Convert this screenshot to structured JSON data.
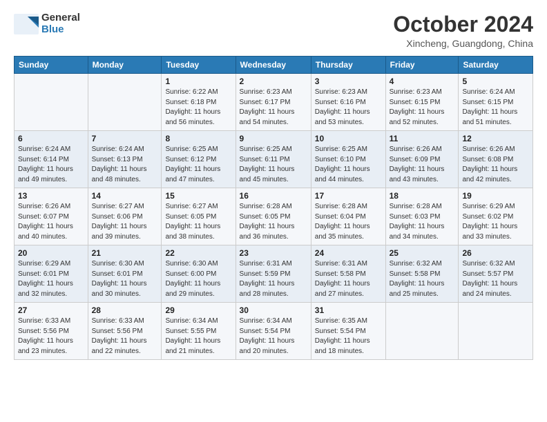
{
  "header": {
    "logo_line1": "General",
    "logo_line2": "Blue",
    "title": "October 2024",
    "subtitle": "Xincheng, Guangdong, China"
  },
  "days_of_week": [
    "Sunday",
    "Monday",
    "Tuesday",
    "Wednesday",
    "Thursday",
    "Friday",
    "Saturday"
  ],
  "weeks": [
    [
      {
        "num": "",
        "detail": ""
      },
      {
        "num": "",
        "detail": ""
      },
      {
        "num": "1",
        "detail": "Sunrise: 6:22 AM\nSunset: 6:18 PM\nDaylight: 11 hours\nand 56 minutes."
      },
      {
        "num": "2",
        "detail": "Sunrise: 6:23 AM\nSunset: 6:17 PM\nDaylight: 11 hours\nand 54 minutes."
      },
      {
        "num": "3",
        "detail": "Sunrise: 6:23 AM\nSunset: 6:16 PM\nDaylight: 11 hours\nand 53 minutes."
      },
      {
        "num": "4",
        "detail": "Sunrise: 6:23 AM\nSunset: 6:15 PM\nDaylight: 11 hours\nand 52 minutes."
      },
      {
        "num": "5",
        "detail": "Sunrise: 6:24 AM\nSunset: 6:15 PM\nDaylight: 11 hours\nand 51 minutes."
      }
    ],
    [
      {
        "num": "6",
        "detail": "Sunrise: 6:24 AM\nSunset: 6:14 PM\nDaylight: 11 hours\nand 49 minutes."
      },
      {
        "num": "7",
        "detail": "Sunrise: 6:24 AM\nSunset: 6:13 PM\nDaylight: 11 hours\nand 48 minutes."
      },
      {
        "num": "8",
        "detail": "Sunrise: 6:25 AM\nSunset: 6:12 PM\nDaylight: 11 hours\nand 47 minutes."
      },
      {
        "num": "9",
        "detail": "Sunrise: 6:25 AM\nSunset: 6:11 PM\nDaylight: 11 hours\nand 45 minutes."
      },
      {
        "num": "10",
        "detail": "Sunrise: 6:25 AM\nSunset: 6:10 PM\nDaylight: 11 hours\nand 44 minutes."
      },
      {
        "num": "11",
        "detail": "Sunrise: 6:26 AM\nSunset: 6:09 PM\nDaylight: 11 hours\nand 43 minutes."
      },
      {
        "num": "12",
        "detail": "Sunrise: 6:26 AM\nSunset: 6:08 PM\nDaylight: 11 hours\nand 42 minutes."
      }
    ],
    [
      {
        "num": "13",
        "detail": "Sunrise: 6:26 AM\nSunset: 6:07 PM\nDaylight: 11 hours\nand 40 minutes."
      },
      {
        "num": "14",
        "detail": "Sunrise: 6:27 AM\nSunset: 6:06 PM\nDaylight: 11 hours\nand 39 minutes."
      },
      {
        "num": "15",
        "detail": "Sunrise: 6:27 AM\nSunset: 6:05 PM\nDaylight: 11 hours\nand 38 minutes."
      },
      {
        "num": "16",
        "detail": "Sunrise: 6:28 AM\nSunset: 6:05 PM\nDaylight: 11 hours\nand 36 minutes."
      },
      {
        "num": "17",
        "detail": "Sunrise: 6:28 AM\nSunset: 6:04 PM\nDaylight: 11 hours\nand 35 minutes."
      },
      {
        "num": "18",
        "detail": "Sunrise: 6:28 AM\nSunset: 6:03 PM\nDaylight: 11 hours\nand 34 minutes."
      },
      {
        "num": "19",
        "detail": "Sunrise: 6:29 AM\nSunset: 6:02 PM\nDaylight: 11 hours\nand 33 minutes."
      }
    ],
    [
      {
        "num": "20",
        "detail": "Sunrise: 6:29 AM\nSunset: 6:01 PM\nDaylight: 11 hours\nand 32 minutes."
      },
      {
        "num": "21",
        "detail": "Sunrise: 6:30 AM\nSunset: 6:01 PM\nDaylight: 11 hours\nand 30 minutes."
      },
      {
        "num": "22",
        "detail": "Sunrise: 6:30 AM\nSunset: 6:00 PM\nDaylight: 11 hours\nand 29 minutes."
      },
      {
        "num": "23",
        "detail": "Sunrise: 6:31 AM\nSunset: 5:59 PM\nDaylight: 11 hours\nand 28 minutes."
      },
      {
        "num": "24",
        "detail": "Sunrise: 6:31 AM\nSunset: 5:58 PM\nDaylight: 11 hours\nand 27 minutes."
      },
      {
        "num": "25",
        "detail": "Sunrise: 6:32 AM\nSunset: 5:58 PM\nDaylight: 11 hours\nand 25 minutes."
      },
      {
        "num": "26",
        "detail": "Sunrise: 6:32 AM\nSunset: 5:57 PM\nDaylight: 11 hours\nand 24 minutes."
      }
    ],
    [
      {
        "num": "27",
        "detail": "Sunrise: 6:33 AM\nSunset: 5:56 PM\nDaylight: 11 hours\nand 23 minutes."
      },
      {
        "num": "28",
        "detail": "Sunrise: 6:33 AM\nSunset: 5:56 PM\nDaylight: 11 hours\nand 22 minutes."
      },
      {
        "num": "29",
        "detail": "Sunrise: 6:34 AM\nSunset: 5:55 PM\nDaylight: 11 hours\nand 21 minutes."
      },
      {
        "num": "30",
        "detail": "Sunrise: 6:34 AM\nSunset: 5:54 PM\nDaylight: 11 hours\nand 20 minutes."
      },
      {
        "num": "31",
        "detail": "Sunrise: 6:35 AM\nSunset: 5:54 PM\nDaylight: 11 hours\nand 18 minutes."
      },
      {
        "num": "",
        "detail": ""
      },
      {
        "num": "",
        "detail": ""
      }
    ]
  ]
}
